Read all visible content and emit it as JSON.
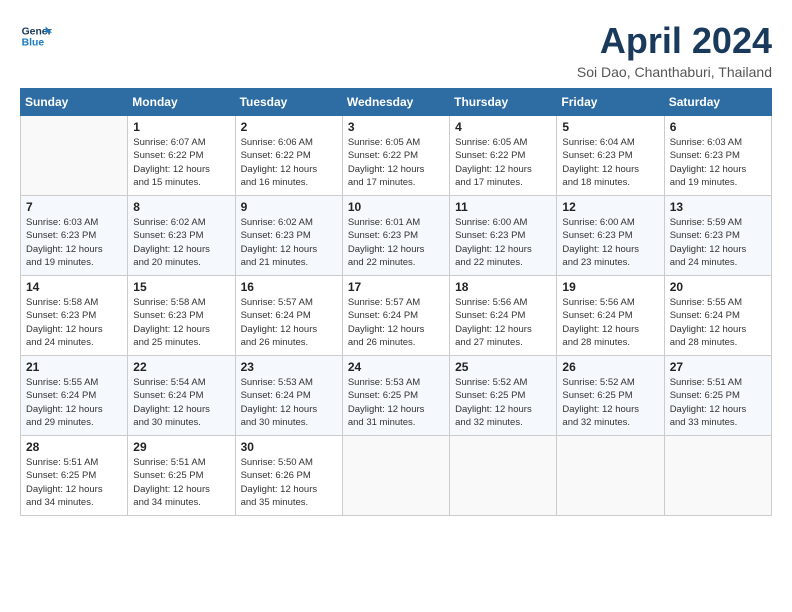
{
  "header": {
    "logo_line1": "General",
    "logo_line2": "Blue",
    "month_title": "April 2024",
    "subtitle": "Soi Dao, Chanthaburi, Thailand"
  },
  "weekdays": [
    "Sunday",
    "Monday",
    "Tuesday",
    "Wednesday",
    "Thursday",
    "Friday",
    "Saturday"
  ],
  "weeks": [
    [
      {
        "day": "",
        "info": ""
      },
      {
        "day": "1",
        "info": "Sunrise: 6:07 AM\nSunset: 6:22 PM\nDaylight: 12 hours\nand 15 minutes."
      },
      {
        "day": "2",
        "info": "Sunrise: 6:06 AM\nSunset: 6:22 PM\nDaylight: 12 hours\nand 16 minutes."
      },
      {
        "day": "3",
        "info": "Sunrise: 6:05 AM\nSunset: 6:22 PM\nDaylight: 12 hours\nand 17 minutes."
      },
      {
        "day": "4",
        "info": "Sunrise: 6:05 AM\nSunset: 6:22 PM\nDaylight: 12 hours\nand 17 minutes."
      },
      {
        "day": "5",
        "info": "Sunrise: 6:04 AM\nSunset: 6:23 PM\nDaylight: 12 hours\nand 18 minutes."
      },
      {
        "day": "6",
        "info": "Sunrise: 6:03 AM\nSunset: 6:23 PM\nDaylight: 12 hours\nand 19 minutes."
      }
    ],
    [
      {
        "day": "7",
        "info": "Sunrise: 6:03 AM\nSunset: 6:23 PM\nDaylight: 12 hours\nand 19 minutes."
      },
      {
        "day": "8",
        "info": "Sunrise: 6:02 AM\nSunset: 6:23 PM\nDaylight: 12 hours\nand 20 minutes."
      },
      {
        "day": "9",
        "info": "Sunrise: 6:02 AM\nSunset: 6:23 PM\nDaylight: 12 hours\nand 21 minutes."
      },
      {
        "day": "10",
        "info": "Sunrise: 6:01 AM\nSunset: 6:23 PM\nDaylight: 12 hours\nand 22 minutes."
      },
      {
        "day": "11",
        "info": "Sunrise: 6:00 AM\nSunset: 6:23 PM\nDaylight: 12 hours\nand 22 minutes."
      },
      {
        "day": "12",
        "info": "Sunrise: 6:00 AM\nSunset: 6:23 PM\nDaylight: 12 hours\nand 23 minutes."
      },
      {
        "day": "13",
        "info": "Sunrise: 5:59 AM\nSunset: 6:23 PM\nDaylight: 12 hours\nand 24 minutes."
      }
    ],
    [
      {
        "day": "14",
        "info": "Sunrise: 5:58 AM\nSunset: 6:23 PM\nDaylight: 12 hours\nand 24 minutes."
      },
      {
        "day": "15",
        "info": "Sunrise: 5:58 AM\nSunset: 6:23 PM\nDaylight: 12 hours\nand 25 minutes."
      },
      {
        "day": "16",
        "info": "Sunrise: 5:57 AM\nSunset: 6:24 PM\nDaylight: 12 hours\nand 26 minutes."
      },
      {
        "day": "17",
        "info": "Sunrise: 5:57 AM\nSunset: 6:24 PM\nDaylight: 12 hours\nand 26 minutes."
      },
      {
        "day": "18",
        "info": "Sunrise: 5:56 AM\nSunset: 6:24 PM\nDaylight: 12 hours\nand 27 minutes."
      },
      {
        "day": "19",
        "info": "Sunrise: 5:56 AM\nSunset: 6:24 PM\nDaylight: 12 hours\nand 28 minutes."
      },
      {
        "day": "20",
        "info": "Sunrise: 5:55 AM\nSunset: 6:24 PM\nDaylight: 12 hours\nand 28 minutes."
      }
    ],
    [
      {
        "day": "21",
        "info": "Sunrise: 5:55 AM\nSunset: 6:24 PM\nDaylight: 12 hours\nand 29 minutes."
      },
      {
        "day": "22",
        "info": "Sunrise: 5:54 AM\nSunset: 6:24 PM\nDaylight: 12 hours\nand 30 minutes."
      },
      {
        "day": "23",
        "info": "Sunrise: 5:53 AM\nSunset: 6:24 PM\nDaylight: 12 hours\nand 30 minutes."
      },
      {
        "day": "24",
        "info": "Sunrise: 5:53 AM\nSunset: 6:25 PM\nDaylight: 12 hours\nand 31 minutes."
      },
      {
        "day": "25",
        "info": "Sunrise: 5:52 AM\nSunset: 6:25 PM\nDaylight: 12 hours\nand 32 minutes."
      },
      {
        "day": "26",
        "info": "Sunrise: 5:52 AM\nSunset: 6:25 PM\nDaylight: 12 hours\nand 32 minutes."
      },
      {
        "day": "27",
        "info": "Sunrise: 5:51 AM\nSunset: 6:25 PM\nDaylight: 12 hours\nand 33 minutes."
      }
    ],
    [
      {
        "day": "28",
        "info": "Sunrise: 5:51 AM\nSunset: 6:25 PM\nDaylight: 12 hours\nand 34 minutes."
      },
      {
        "day": "29",
        "info": "Sunrise: 5:51 AM\nSunset: 6:25 PM\nDaylight: 12 hours\nand 34 minutes."
      },
      {
        "day": "30",
        "info": "Sunrise: 5:50 AM\nSunset: 6:26 PM\nDaylight: 12 hours\nand 35 minutes."
      },
      {
        "day": "",
        "info": ""
      },
      {
        "day": "",
        "info": ""
      },
      {
        "day": "",
        "info": ""
      },
      {
        "day": "",
        "info": ""
      }
    ]
  ]
}
